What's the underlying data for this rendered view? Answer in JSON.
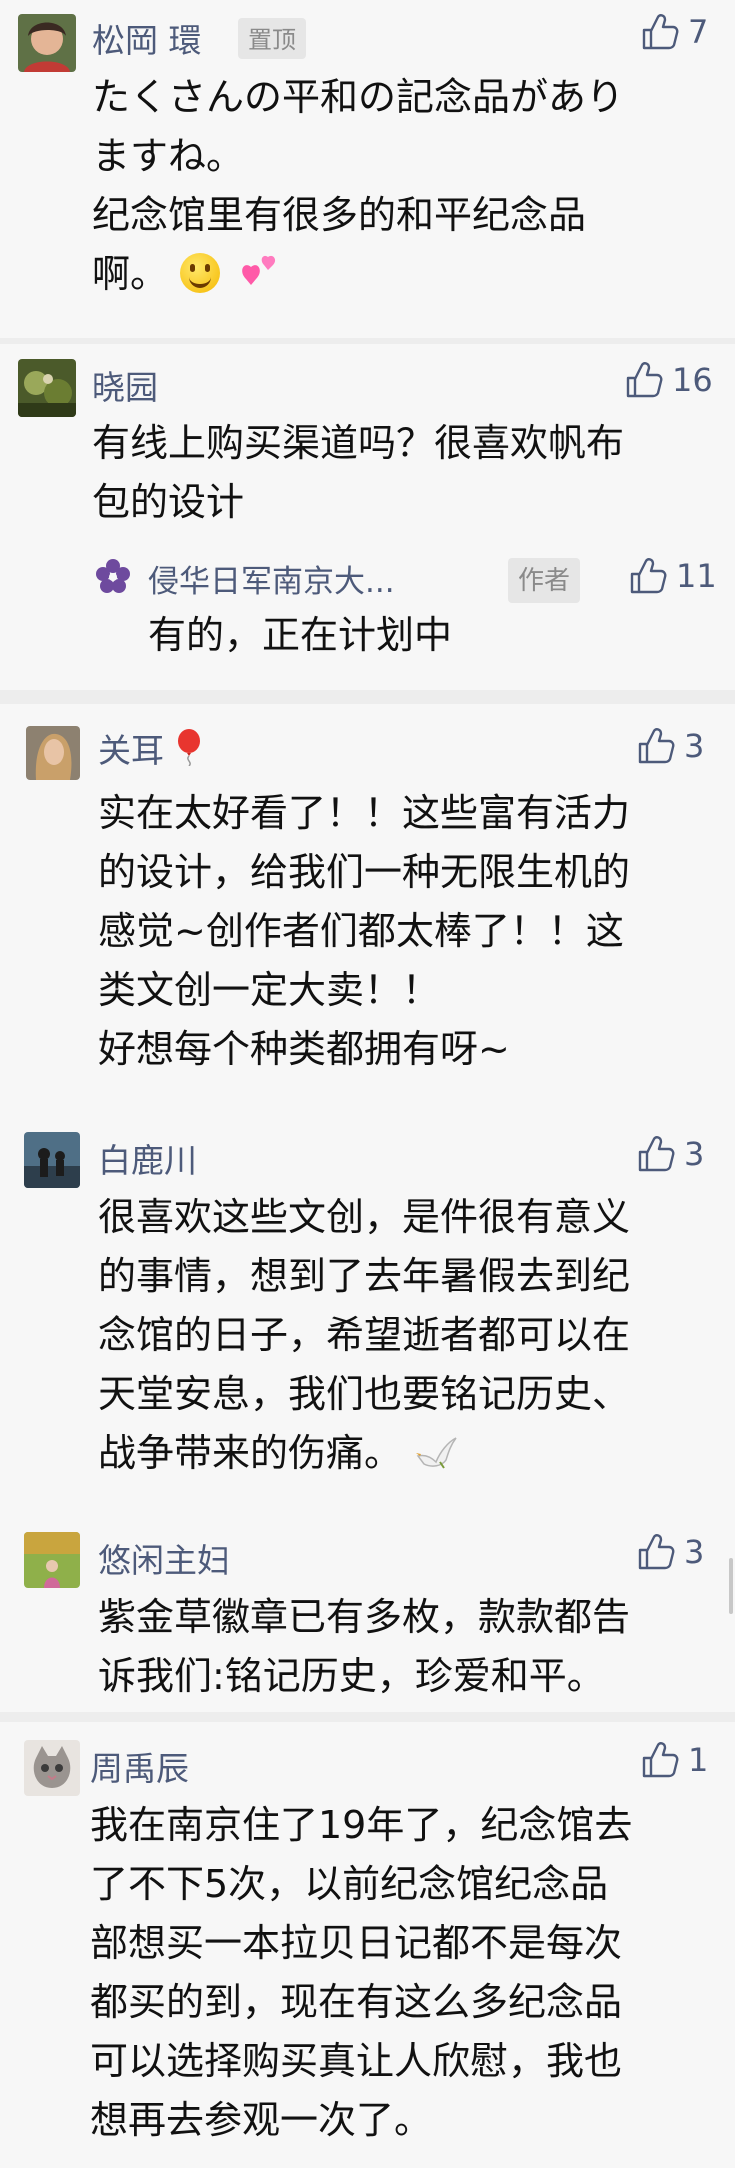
{
  "comments": [
    {
      "name": "松岡 環",
      "pin": "置顶",
      "likes": "7",
      "lines": [
        "たくさんの平和の記念品があり",
        "ますね。",
        "纪念馆里有很多的和平纪念品",
        "啊。"
      ],
      "emojis": [
        "grinning-face",
        "two-hearts"
      ]
    },
    {
      "name": "晓园",
      "likes": "16",
      "lines": [
        "有线上购买渠道吗？很喜欢帆布",
        "包的设计"
      ],
      "reply": {
        "author": "侵华日军南京大...",
        "tag": "作者",
        "likes": "11",
        "text": "有的，正在计划中"
      }
    },
    {
      "name": "关耳",
      "likes": "3",
      "lines": [
        "实在太好看了！！这些富有活力",
        "的设计，给我们一种无限生机的",
        "感觉~创作者们都太棒了！！这",
        "类文创一定大卖！！",
        "好想每个种类都拥有呀~"
      ]
    },
    {
      "name": "白鹿川",
      "likes": "3",
      "lines": [
        "很喜欢这些文创，是件很有意义",
        "的事情，想到了去年暑假去到纪",
        "念馆的日子，希望逝者都可以在",
        "天堂安息，我们也要铭记历史、",
        "战争带来的伤痛。"
      ]
    },
    {
      "name": "悠闲主妇",
      "likes": "3",
      "lines": [
        "紫金草徽章已有多枚，款款都告",
        "诉我们:铭记历史，珍爱和平。"
      ]
    },
    {
      "name": "周禹辰",
      "likes": "1",
      "lines": [
        "我在南京住了19年了，纪念馆去",
        "了不下5次，以前纪念馆纪念品",
        "部想买一本拉贝日记都不是每次",
        "都买的到，现在有这么多纪念品",
        "可以选择购买真让人欣慰，我也",
        "想再去参观一次了。"
      ]
    }
  ],
  "colors": {
    "name": "#4d5a7a",
    "text": "#111111",
    "panel": "#f7f7f7",
    "separator": "#ededed"
  }
}
